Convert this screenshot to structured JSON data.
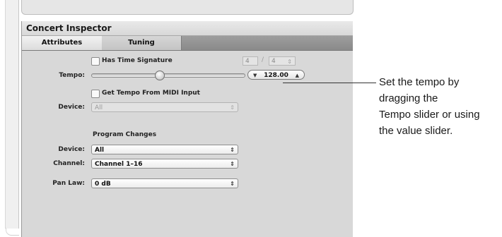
{
  "panel": {
    "title": "Concert Inspector",
    "tabs": [
      {
        "label": "Attributes",
        "active": true
      },
      {
        "label": "Tuning",
        "active": false
      }
    ]
  },
  "attributes": {
    "has_time_signature": {
      "label": "Has Time Signature",
      "checked": false
    },
    "time_signature": {
      "numerator": "4",
      "separator": "/",
      "denominator": "4"
    },
    "tempo": {
      "label": "Tempo:",
      "value": "128.00",
      "slider_fraction": 0.44
    },
    "get_tempo_from_midi": {
      "label": "Get Tempo From MIDI Input",
      "checked": false
    },
    "midi_device": {
      "label": "Device:",
      "value": "All"
    },
    "program_changes": {
      "heading": "Program Changes",
      "device": {
        "label": "Device:",
        "value": "All"
      },
      "channel": {
        "label": "Channel:",
        "value": "Channel 1–16"
      }
    },
    "pan_law": {
      "label": "Pan Law:",
      "value": "0 dB"
    }
  },
  "callout": {
    "lines": [
      "Set the tempo by",
      "dragging the",
      "Tempo slider or using",
      "the value slider."
    ]
  },
  "icons": {
    "up_down_arrows": "⇕",
    "down_arrow": "▼",
    "up_arrow": "▲"
  },
  "colors": {
    "panel_bg": "#d8d8d8",
    "tab_bar": "#929292",
    "callout_line": "#333333"
  }
}
